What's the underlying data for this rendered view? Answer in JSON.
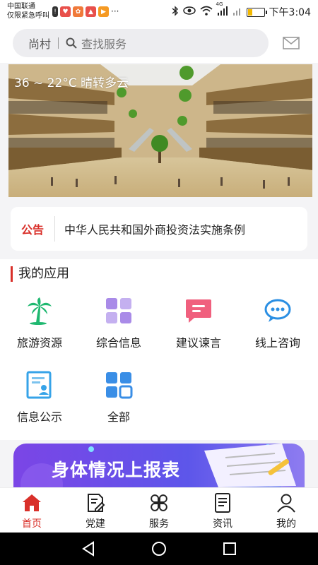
{
  "status_bar": {
    "carrier_line1": "中国联通",
    "carrier_line2": "仅限紧急呼叫",
    "network": "4G",
    "time": "下午3:04",
    "battery_level": 0.3
  },
  "search": {
    "location": "尚村",
    "placeholder": "查找服务"
  },
  "banner": {
    "weather": "36 ~ 22°C  晴转多云"
  },
  "notice": {
    "tag": "公告",
    "text": "中华人民共和国外商投资法实施条例"
  },
  "apps": {
    "title": "我的应用",
    "items": [
      {
        "label": "旅游资源",
        "icon": "palm-tree-icon",
        "color": "#1fb870"
      },
      {
        "label": "综合信息",
        "icon": "grid-icon",
        "color": "#a98be8"
      },
      {
        "label": "建议谏言",
        "icon": "message-icon",
        "color": "#f0607e"
      },
      {
        "label": "线上咨询",
        "icon": "chat-bubbles-icon",
        "color": "#2b8fe3"
      },
      {
        "label": "信息公示",
        "icon": "notice-board-icon",
        "color": "#36a3e8"
      },
      {
        "label": "全部",
        "icon": "all-grid-icon",
        "color": "#3a8ee6"
      }
    ]
  },
  "promo": {
    "text": "身体情况上报表"
  },
  "tabs": [
    {
      "label": "首页",
      "icon": "home-icon",
      "active": true
    },
    {
      "label": "党建",
      "icon": "edit-doc-icon",
      "active": false
    },
    {
      "label": "服务",
      "icon": "clover-icon",
      "active": false
    },
    {
      "label": "资讯",
      "icon": "news-icon",
      "active": false
    },
    {
      "label": "我的",
      "icon": "user-icon",
      "active": false
    }
  ],
  "colors": {
    "accent": "#d9302a",
    "promo": "#6b4de8"
  }
}
